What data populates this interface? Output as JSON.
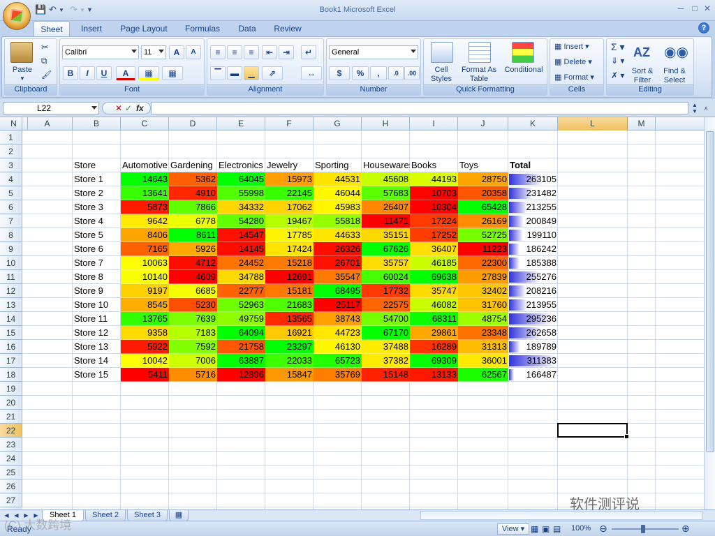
{
  "app": {
    "title": "Book1  Microsoft Excel",
    "status": "Ready",
    "zoom": "100%",
    "watermark": "软件测评说",
    "watermark2": "(C) 大数跨境"
  },
  "tabs": [
    "Sheet",
    "Insert",
    "Page Layout",
    "Formulas",
    "Data",
    "Review"
  ],
  "active_tab": "Sheet",
  "ribbon": {
    "clipboard": {
      "label": "Clipboard",
      "paste": "Paste"
    },
    "font": {
      "label": "Font",
      "name": "Calibri",
      "size": "11"
    },
    "alignment": {
      "label": "Alignment"
    },
    "number": {
      "label": "Number",
      "format": "General"
    },
    "quick_formatting": {
      "label": "Quick Formatting",
      "cell_styles": "Cell Styles",
      "format_table": "Format As Table",
      "conditional": "Conditional"
    },
    "cells": {
      "label": "Cells",
      "insert": "Insert",
      "delete": "Delete",
      "format": "Format"
    },
    "editing": {
      "label": "Editing",
      "sort": "Sort & Filter",
      "find": "Find & Select"
    }
  },
  "formula_bar": {
    "name_box": "L22",
    "formula": ""
  },
  "columns": [
    "A",
    "B",
    "C",
    "D",
    "E",
    "F",
    "G",
    "H",
    "I",
    "J",
    "K",
    "L",
    "M",
    "N"
  ],
  "rows": [
    "1",
    "2",
    "3",
    "4",
    "5",
    "6",
    "7",
    "8",
    "9",
    "10",
    "11",
    "12",
    "13",
    "14",
    "15",
    "16",
    "17",
    "18",
    "19",
    "20",
    "21",
    "22",
    "23",
    "24",
    "25",
    "26",
    "27"
  ],
  "selected_cell": "L22",
  "table": {
    "headers": [
      "Store",
      "Automotive",
      "Gardening",
      "Electronics",
      "Jewelry",
      "Sporting",
      "Housewares",
      "Books",
      "Toys",
      "Total"
    ],
    "rows": [
      [
        "Store 1",
        14643,
        5362,
        64045,
        15973,
        44531,
        45608,
        44193,
        28750,
        263105
      ],
      [
        "Store 2",
        13641,
        4910,
        55998,
        22145,
        46044,
        57683,
        10703,
        20358,
        231482
      ],
      [
        "Store 3",
        5873,
        7866,
        34332,
        17062,
        45983,
        26407,
        10304,
        65428,
        213255
      ],
      [
        "Store 4",
        9642,
        6778,
        54280,
        19467,
        55818,
        11471,
        17224,
        26169,
        200849
      ],
      [
        "Store 5",
        8406,
        8611,
        14547,
        17785,
        44633,
        35151,
        17252,
        52725,
        199110
      ],
      [
        "Store 6",
        7165,
        5926,
        14145,
        17424,
        26326,
        67626,
        36407,
        11223,
        186242
      ],
      [
        "Store 7",
        10063,
        4712,
        24452,
        15218,
        26701,
        35757,
        46185,
        22300,
        185388
      ],
      [
        "Store 8",
        10140,
        4609,
        34788,
        12691,
        35547,
        60024,
        69638,
        27839,
        255276
      ],
      [
        "Store 9",
        9197,
        6685,
        22777,
        15181,
        68495,
        17732,
        35747,
        32402,
        208216
      ],
      [
        "Store 10",
        8545,
        5230,
        52963,
        21683,
        25117,
        22575,
        46082,
        31760,
        213955
      ],
      [
        "Store 11",
        13765,
        7639,
        49759,
        13565,
        38743,
        54700,
        68311,
        48754,
        295236
      ],
      [
        "Store 12",
        9358,
        7183,
        64094,
        16921,
        44723,
        67170,
        29861,
        23348,
        262658
      ],
      [
        "Store 13",
        5922,
        7592,
        21758,
        23297,
        46130,
        37488,
        16289,
        31313,
        189789
      ],
      [
        "Store 14",
        10042,
        7006,
        63887,
        22033,
        65723,
        37382,
        69309,
        36001,
        311383
      ],
      [
        "Store 15",
        5411,
        5716,
        12896,
        15847,
        35769,
        15148,
        13133,
        62567,
        166487
      ]
    ]
  },
  "sheets": [
    "Sheet 1",
    "Sheet 2",
    "Sheet 3"
  ],
  "active_sheet": "Sheet 1",
  "colors": {
    "low": "#ff0000",
    "mid": "#ffff00",
    "high": "#00ff00",
    "databar": "#3333dd"
  }
}
